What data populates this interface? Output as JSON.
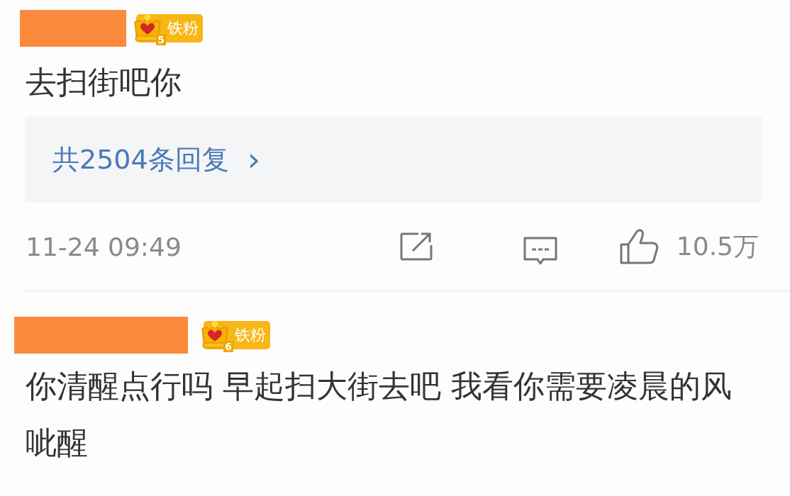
{
  "comments": [
    {
      "name_redacted": true,
      "badge": {
        "rank": "5",
        "label": "铁粉"
      },
      "text": "去扫街吧你",
      "replies": {
        "label": "共2504条回复",
        "arrow": "›"
      },
      "time": "11-24 09:49",
      "likes": "10.5万"
    },
    {
      "name_redacted": true,
      "badge": {
        "rank": "6",
        "label": "铁粉"
      },
      "text": "你清醒点行吗 早起扫大街去吧 我看你需要凌晨的风呲醒"
    }
  ]
}
